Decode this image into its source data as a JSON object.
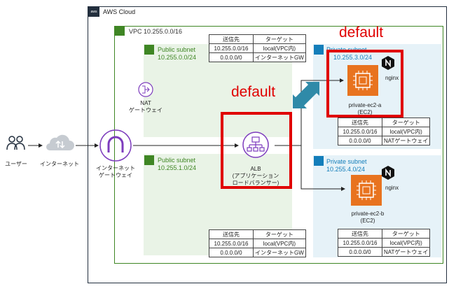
{
  "cloud": {
    "title": "AWS Cloud",
    "badge": "aws"
  },
  "vpc": {
    "title": "VPC 10.255.0.0/16"
  },
  "subnets": {
    "public_a": {
      "title": "Public subnet",
      "cidr": "10.255.0.0/24"
    },
    "public_c": {
      "title": "Public subnet",
      "cidr": "10.255.1.0/24"
    },
    "private_a": {
      "title": "Private subnet",
      "cidr": "10.255.3.0/24"
    },
    "private_c": {
      "title": "Private subnet",
      "cidr": "10.255.4.0/24"
    }
  },
  "nodes": {
    "user": "ユーザー",
    "internet": "インターネット",
    "igw": [
      "インターネット",
      "ゲートウェイ"
    ],
    "nat": [
      "NAT",
      "ゲートウェイ"
    ],
    "alb": [
      "ALB",
      "(アプリケーション",
      "ロードバランサー)"
    ],
    "ec2_a": [
      "private-ec2-a",
      "(EC2)"
    ],
    "ec2_b": [
      "private-ec2-b",
      "(EC2)"
    ],
    "nginx": "nginx"
  },
  "annotations": {
    "default_alb": "default",
    "default_ec2": "default"
  },
  "route_tables": {
    "public_top": {
      "header": [
        "送信先",
        "ターゲット"
      ],
      "rows": [
        [
          "10.255.0.0/16",
          "local(VPC内)"
        ],
        [
          "0.0.0.0/0",
          "インターネットGW"
        ]
      ]
    },
    "public_bottom": {
      "header": [
        "送信先",
        "ターゲット"
      ],
      "rows": [
        [
          "10.255.0.0/16",
          "local(VPC内)"
        ],
        [
          "0.0.0.0/0",
          "インターネットGW"
        ]
      ]
    },
    "private_top": {
      "header": [
        "送信先",
        "ターゲット"
      ],
      "rows": [
        [
          "10.255.0.0/16",
          "local(VPC内)"
        ],
        [
          "0.0.0.0/0",
          "NATゲートウェイ"
        ]
      ]
    },
    "private_bottom": {
      "header": [
        "送信先",
        "ターゲット"
      ],
      "rows": [
        [
          "10.255.0.0/16",
          "local(VPC内)"
        ],
        [
          "0.0.0.0/0",
          "NATゲートウェイ"
        ]
      ]
    }
  }
}
